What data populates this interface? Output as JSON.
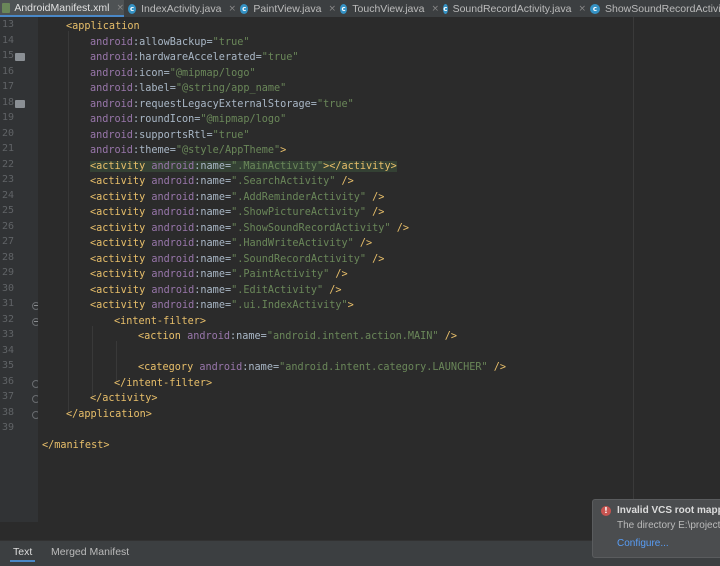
{
  "tabs": [
    {
      "label": "AndroidManifest.xml",
      "kind": "xml",
      "active": true
    },
    {
      "label": "IndexActivity.java",
      "kind": "class"
    },
    {
      "label": "PaintView.java",
      "kind": "class"
    },
    {
      "label": "TouchView.java",
      "kind": "class"
    },
    {
      "label": "SoundRecordActivity.java",
      "kind": "class"
    },
    {
      "label": "ShowSoundRecordActivity",
      "kind": "class"
    }
  ],
  "tab_close_glyph": "×",
  "class_icon_letter": "c",
  "line_numbers": [
    "13",
    "14",
    "15",
    "16",
    "17",
    "18",
    "19",
    "20",
    "21",
    "22",
    "23",
    "24",
    "25",
    "26",
    "27",
    "28",
    "29",
    "30",
    "31",
    "32",
    "33",
    "34",
    "35",
    "36",
    "37",
    "38",
    "39"
  ],
  "code_lines": [
    [
      {
        "t": "tag",
        "v": "<application"
      }
    ],
    [
      {
        "t": "pfx",
        "v": "android"
      },
      {
        "t": "plain",
        "v": ":allowBackup="
      },
      {
        "t": "val",
        "v": "\"true\""
      }
    ],
    [
      {
        "t": "pfx",
        "v": "android"
      },
      {
        "t": "plain",
        "v": ":hardwareAccelerated="
      },
      {
        "t": "val",
        "v": "\"true\""
      }
    ],
    [
      {
        "t": "pfx",
        "v": "android"
      },
      {
        "t": "plain",
        "v": ":icon="
      },
      {
        "t": "val",
        "v": "\"@mipmap/logo\""
      }
    ],
    [
      {
        "t": "pfx",
        "v": "android"
      },
      {
        "t": "plain",
        "v": ":label="
      },
      {
        "t": "val",
        "v": "\"@string/app_name\""
      }
    ],
    [
      {
        "t": "pfx",
        "v": "android"
      },
      {
        "t": "plain",
        "v": ":requestLegacyExternalStorage="
      },
      {
        "t": "val",
        "v": "\"true\""
      }
    ],
    [
      {
        "t": "pfx",
        "v": "android"
      },
      {
        "t": "plain",
        "v": ":roundIcon="
      },
      {
        "t": "val",
        "v": "\"@mipmap/logo\""
      }
    ],
    [
      {
        "t": "pfx",
        "v": "android"
      },
      {
        "t": "plain",
        "v": ":supportsRtl="
      },
      {
        "t": "val",
        "v": "\"true\""
      }
    ],
    [
      {
        "t": "pfx",
        "v": "android"
      },
      {
        "t": "plain",
        "v": ":theme="
      },
      {
        "t": "val",
        "v": "\"@style/AppTheme\""
      },
      {
        "t": "tag",
        "v": ">"
      }
    ],
    [
      {
        "t": "tag",
        "v": "<activity "
      },
      {
        "t": "ns",
        "v": "android"
      },
      {
        "t": "plain",
        "v": ":name="
      },
      {
        "t": "val",
        "v": "\".MainActivity\""
      },
      {
        "t": "tag",
        "v": "></activity>"
      }
    ],
    [
      {
        "t": "tag",
        "v": "<activity "
      },
      {
        "t": "ns",
        "v": "android"
      },
      {
        "t": "plain",
        "v": ":name="
      },
      {
        "t": "val",
        "v": "\".SearchActivity\""
      },
      {
        "t": "tag",
        "v": " />"
      }
    ],
    [
      {
        "t": "tag",
        "v": "<activity "
      },
      {
        "t": "ns",
        "v": "android"
      },
      {
        "t": "plain",
        "v": ":name="
      },
      {
        "t": "val",
        "v": "\".AddReminderActivity\""
      },
      {
        "t": "tag",
        "v": " />"
      }
    ],
    [
      {
        "t": "tag",
        "v": "<activity "
      },
      {
        "t": "ns",
        "v": "android"
      },
      {
        "t": "plain",
        "v": ":name="
      },
      {
        "t": "val",
        "v": "\".ShowPictureActivity\""
      },
      {
        "t": "tag",
        "v": " />"
      }
    ],
    [
      {
        "t": "tag",
        "v": "<activity "
      },
      {
        "t": "ns",
        "v": "android"
      },
      {
        "t": "plain",
        "v": ":name="
      },
      {
        "t": "val",
        "v": "\".ShowSoundRecordActivity\""
      },
      {
        "t": "tag",
        "v": " />"
      }
    ],
    [
      {
        "t": "tag",
        "v": "<activity "
      },
      {
        "t": "ns",
        "v": "android"
      },
      {
        "t": "plain",
        "v": ":name="
      },
      {
        "t": "val",
        "v": "\".HandWriteActivity\""
      },
      {
        "t": "tag",
        "v": " />"
      }
    ],
    [
      {
        "t": "tag",
        "v": "<activity "
      },
      {
        "t": "ns",
        "v": "android"
      },
      {
        "t": "plain",
        "v": ":name="
      },
      {
        "t": "val",
        "v": "\".SoundRecordActivity\""
      },
      {
        "t": "tag",
        "v": " />"
      }
    ],
    [
      {
        "t": "tag",
        "v": "<activity "
      },
      {
        "t": "ns",
        "v": "android"
      },
      {
        "t": "plain",
        "v": ":name="
      },
      {
        "t": "val",
        "v": "\".PaintActivity\""
      },
      {
        "t": "tag",
        "v": " />"
      }
    ],
    [
      {
        "t": "tag",
        "v": "<activity "
      },
      {
        "t": "ns",
        "v": "android"
      },
      {
        "t": "plain",
        "v": ":name="
      },
      {
        "t": "val",
        "v": "\".EditActivity\""
      },
      {
        "t": "tag",
        "v": " />"
      }
    ],
    [
      {
        "t": "tag",
        "v": "<activity "
      },
      {
        "t": "ns",
        "v": "android"
      },
      {
        "t": "plain",
        "v": ":name="
      },
      {
        "t": "val",
        "v": "\".ui.IndexActivity\""
      },
      {
        "t": "tag",
        "v": ">"
      }
    ],
    [
      {
        "t": "tag",
        "v": "<intent-filter>"
      }
    ],
    [
      {
        "t": "tag",
        "v": "<action "
      },
      {
        "t": "ns",
        "v": "android"
      },
      {
        "t": "plain",
        "v": ":name="
      },
      {
        "t": "val",
        "v": "\"android.intent.action.MAIN\""
      },
      {
        "t": "tag",
        "v": " />"
      }
    ],
    [],
    [
      {
        "t": "tag",
        "v": "<category "
      },
      {
        "t": "ns",
        "v": "android"
      },
      {
        "t": "plain",
        "v": ":name="
      },
      {
        "t": "val",
        "v": "\"android.intent.category.LAUNCHER\""
      },
      {
        "t": "tag",
        "v": " />"
      }
    ],
    [
      {
        "t": "tag",
        "v": "</intent-filter>"
      }
    ],
    [
      {
        "t": "tag",
        "v": "</activity>"
      }
    ],
    [
      {
        "t": "tag",
        "v": "</application>"
      }
    ],
    [],
    [
      {
        "t": "tag",
        "v": "</manifest>"
      }
    ]
  ],
  "bottom_tabs": [
    "Text",
    "Merged Manifest"
  ],
  "notification": {
    "icon": "!",
    "title": "Invalid VCS root mapping",
    "body": "The directory E:\\project",
    "link": "Configure..."
  },
  "colors": {
    "background": "#2b2b2b",
    "tag": "#e8bf6a",
    "namespace": "#9876aa",
    "value": "#6a8759",
    "line_highlight": "#344134"
  }
}
